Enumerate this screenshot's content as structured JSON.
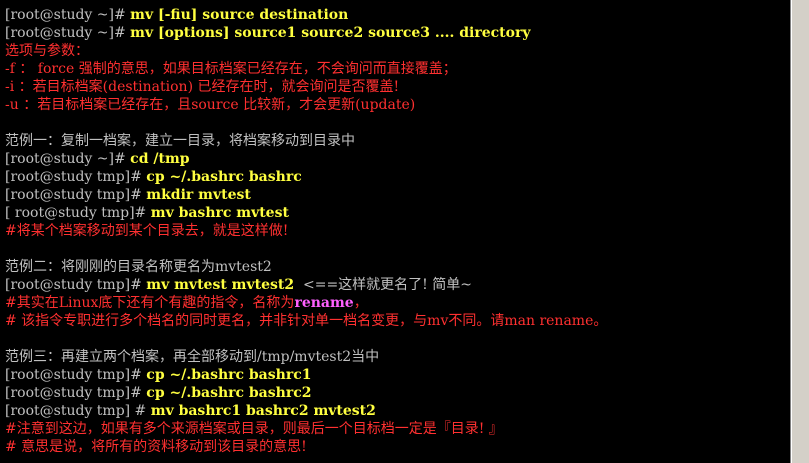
{
  "terminal": {
    "lines": [
      {
        "prompt": "[root@study ~]# ",
        "cmd": "mv [-fiu] source destination"
      },
      {
        "prompt": "[root@study ~]# ",
        "cmd": "mv [options] source1 source2 source3 .... directory"
      },
      {
        "text": "选项与参数："
      },
      {
        "text": "-f ： force 强制的意思，如果目标档案已经存在，不会询问而直接覆盖；"
      },
      {
        "text": "-i ：若目标档案(destination) 已经存在时，就会询问是否覆盖!"
      },
      {
        "text": "-u ：若目标档案已经存在，且source 比较新，才会更新(update)"
      },
      {
        "text": ""
      },
      {
        "text": "范例一：复制一档案，建立一目录，将档案移动到目录中"
      },
      {
        "prompt": "[root@study ~]# ",
        "cmd": "cd /tmp"
      },
      {
        "prompt": "[root@study tmp]# ",
        "cmd": "cp ~/.bashrc bashrc"
      },
      {
        "prompt": "[root@study tmp]# ",
        "cmd": "mkdir mvtest"
      },
      {
        "prompt": "[ root@study tmp]# ",
        "cmd": "mv bashrc mvtest"
      },
      {
        "text": "#将某个档案移动到某个目录去，就是这样做!"
      },
      {
        "text": ""
      },
      {
        "text": "范例二：将刚刚的目录名称更名为mvtest2"
      },
      {
        "prompt": "[root@study tmp]# ",
        "cmd": "mv mvtest mvtest2",
        "note": "  <==这样就更名了! 简单~"
      },
      {
        "pre": "#其实在Linux底下还有个有趣的指令，名称为",
        "hl": "rename",
        "post": "，"
      },
      {
        "text": "# 该指令专职进行多个档名的同时更名，并非针对单一档名变更，与mv不同。请man rename。"
      },
      {
        "text": ""
      },
      {
        "text": "范例三：再建立两个档案，再全部移动到/tmp/mvtest2当中"
      },
      {
        "prompt": "[root@study tmp]# ",
        "cmd": "cp ~/.bashrc bashrc1"
      },
      {
        "prompt": "[root@study tmp]# ",
        "cmd": "cp ~/.bashrc bashrc2"
      },
      {
        "prompt": "[root@study tmp] # ",
        "cmd": "mv bashrc1 bashrc2 mvtest2"
      },
      {
        "text": "#注意到这边，如果有多个来源档案或目录，则最后一个目标档一定是『目录! 』"
      },
      {
        "text": "# 意思是说，将所有的资料移动到该目录的意思!"
      }
    ]
  }
}
